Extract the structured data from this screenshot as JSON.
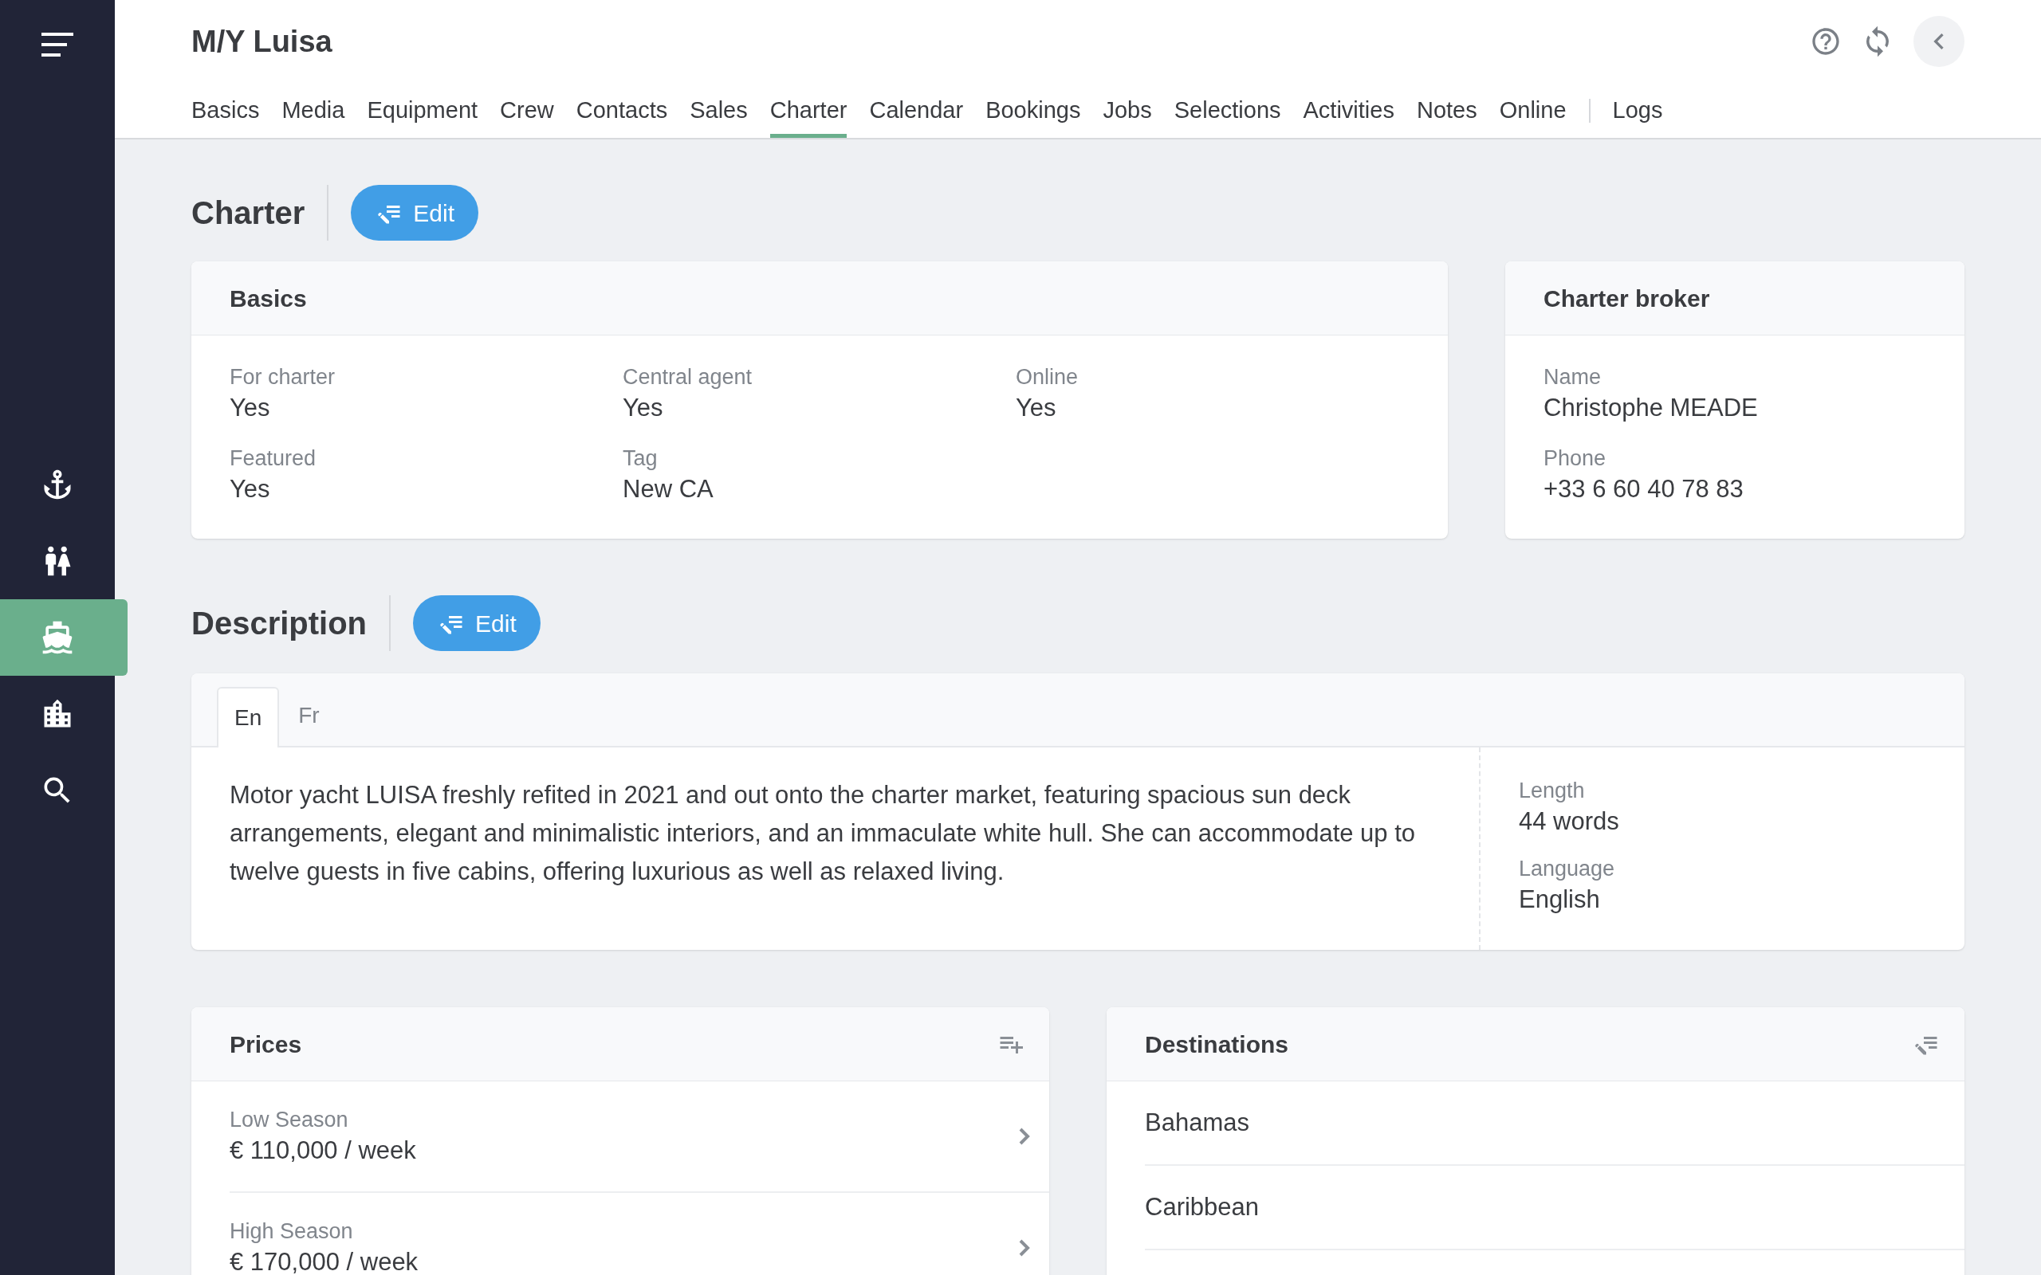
{
  "sidebar": {
    "items": [
      {
        "kind": "anchor",
        "selected": false
      },
      {
        "kind": "people",
        "selected": false
      },
      {
        "kind": "boat",
        "selected": true
      },
      {
        "kind": "building",
        "selected": false
      },
      {
        "kind": "search",
        "selected": false
      }
    ]
  },
  "header": {
    "title": "M/Y Luisa",
    "tabs": [
      {
        "label": "Basics",
        "selected": false
      },
      {
        "label": "Media",
        "selected": false
      },
      {
        "label": "Equipment",
        "selected": false
      },
      {
        "label": "Crew",
        "selected": false
      },
      {
        "label": "Contacts",
        "selected": false
      },
      {
        "label": "Sales",
        "selected": false
      },
      {
        "label": "Charter",
        "selected": true
      },
      {
        "label": "Calendar",
        "selected": false
      },
      {
        "label": "Bookings",
        "selected": false
      },
      {
        "label": "Jobs",
        "selected": false
      },
      {
        "label": "Selections",
        "selected": false
      },
      {
        "label": "Activities",
        "selected": false
      },
      {
        "label": "Notes",
        "selected": false
      },
      {
        "label": "Online",
        "selected": false
      }
    ],
    "secondary_tabs": [
      {
        "label": "Logs",
        "selected": false
      }
    ]
  },
  "charter": {
    "title": "Charter",
    "edit_label": "Edit",
    "basics": {
      "title": "Basics",
      "fields": [
        {
          "label": "For charter",
          "value": "Yes"
        },
        {
          "label": "Central agent",
          "value": "Yes"
        },
        {
          "label": "Online",
          "value": "Yes"
        },
        {
          "label": "Featured",
          "value": "Yes"
        },
        {
          "label": "Tag",
          "value": "New CA"
        }
      ]
    },
    "broker": {
      "title": "Charter broker",
      "fields": [
        {
          "label": "Name",
          "value": "Christophe MEADE"
        },
        {
          "label": "Phone",
          "value": "+33 6 60 40 78 83"
        }
      ]
    }
  },
  "description": {
    "title": "Description",
    "edit_label": "Edit",
    "languages": [
      {
        "label": "En",
        "selected": true
      },
      {
        "label": "Fr",
        "selected": false
      }
    ],
    "text": "Motor yacht LUISA freshly refited in 2021 and out onto the charter market, featuring spacious sun deck arrangements, elegant and minimalistic interiors, and an immaculate white hull. She can accommodate up to twelve guests in five cabins, offering luxurious as well as relaxed living.",
    "stats": [
      {
        "label": "Length",
        "value": "44 words"
      },
      {
        "label": "Language",
        "value": "English"
      }
    ]
  },
  "prices": {
    "title": "Prices",
    "items": [
      {
        "label": "Low Season",
        "value": "€ 110,000 / week"
      },
      {
        "label": "High Season",
        "value": "€ 170,000 / week"
      }
    ]
  },
  "destinations": {
    "title": "Destinations",
    "items": [
      "Bahamas",
      "Caribbean"
    ]
  }
}
